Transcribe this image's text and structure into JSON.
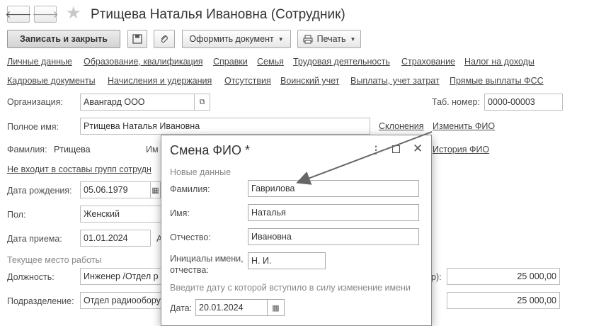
{
  "window": {
    "title": "Ртищева Наталья Ивановна (Сотрудник)",
    "nav": {
      "back_icon": "arrow-left-icon",
      "forward_icon": "arrow-right-icon",
      "favorite_icon": "star-icon"
    }
  },
  "toolbar": {
    "save_close": "Записать и закрыть",
    "save_icon": "floppy-disk-icon",
    "attach_icon": "paperclip-icon",
    "create_doc": "Оформить документ",
    "print": "Печать"
  },
  "links_row1": [
    "Личные данные",
    "Образование, квалификация",
    "Справки",
    "Семья",
    "Трудовая деятельность",
    "Страхование",
    "Налог на доходы"
  ],
  "links_row2": [
    "Кадровые документы",
    "Начисления и удержания",
    "Отсутствия",
    "Воинский учет",
    "Выплаты, учет затрат",
    "Прямые выплаты ФСС"
  ],
  "form": {
    "org_label": "Организация:",
    "org_value": "Авангард ООО",
    "tab_label": "Таб. номер:",
    "tab_value": "0000-00003",
    "fullname_label": "Полное имя:",
    "fullname_value": "Ртищева Наталья Ивановна",
    "declensions_link": "Склонения",
    "change_fio_link": "Изменить ФИО",
    "surname_label": "Фамилия:",
    "surname_value": "Ртищева",
    "name_label_partial": "Им",
    "history_link": "История ФИО",
    "groups_link": "Не входит в составы групп сотрудн",
    "birth_label": "Дата рождения:",
    "birth_value": "05.06.1979",
    "gender_label": "Пол:",
    "gender_value": "Женский",
    "hire_label": "Дата приема:",
    "hire_value": "01.01.2024",
    "workplace_section": "Текущее место работы",
    "position_label": "Должность:",
    "position_value": "Инженер /Отдел р",
    "dept_label": "Подразделение:",
    "dept_value": "Отдел радиообору",
    "salary_label_partial": "р):",
    "salary_value": "25 000,00",
    "salary_value2": "25 000,00"
  },
  "dialog": {
    "title": "Смена ФИО *",
    "menu_icon": "more-vertical-icon",
    "maximize_icon": "maximize-icon",
    "close_icon": "close-icon",
    "new_data_section": "Новые данные",
    "surname_label": "Фамилия:",
    "surname_value": "Гаврилова",
    "name_label": "Имя:",
    "name_value": "Наталья",
    "patronymic_label": "Отчество:",
    "patronymic_value": "Ивановна",
    "initials_label_line1": "Инициалы имени,",
    "initials_label_line2": "отчества:",
    "initials_value": "Н. И.",
    "date_hint": "Введите дату с которой вступило в силу изменение имени",
    "date_label": "Дата:",
    "date_value": "20.01.2024"
  }
}
